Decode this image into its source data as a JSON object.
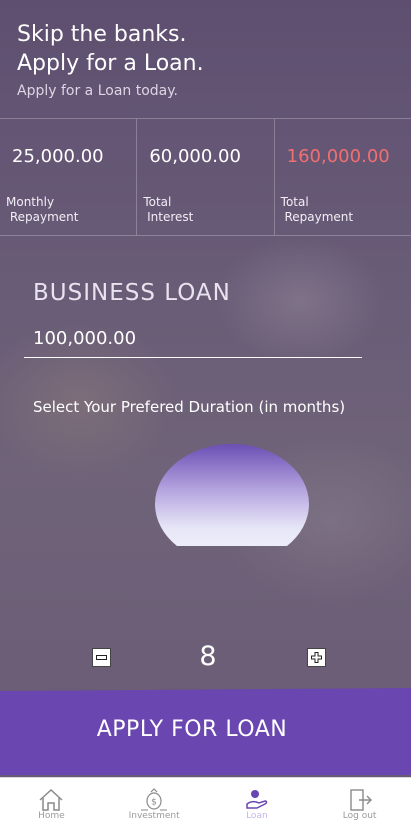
{
  "hero": {
    "title_line1": "Skip the banks.",
    "title_line2": "Apply for a Loan.",
    "subtitle": "Apply for a Loan today."
  },
  "stats": [
    {
      "value": "25,000.00",
      "label": "Monthly\n Repayment",
      "color": "#ffffff"
    },
    {
      "value": "60,000.00",
      "label": "Total\n Interest",
      "color": "#ffffff"
    },
    {
      "value": "160,000.00",
      "label": "Total\n Repayment",
      "color": "#f07070"
    }
  ],
  "loan": {
    "title": "BUSINESS LOAN",
    "amount": "100,000.00",
    "duration_label": "Select Your Prefered Duration (in months)",
    "duration_value": "8"
  },
  "apply_button": {
    "label": "APPLY FOR LOAN",
    "color": "#6a46b0"
  },
  "tabbar": {
    "items": [
      {
        "label": "Home",
        "icon": "home-icon"
      },
      {
        "label": "Investment",
        "icon": "money-bag-icon"
      },
      {
        "label": "Loan",
        "icon": "loan-hand-icon",
        "active": true
      },
      {
        "label": "Log out",
        "icon": "logout-door-icon"
      }
    ]
  }
}
